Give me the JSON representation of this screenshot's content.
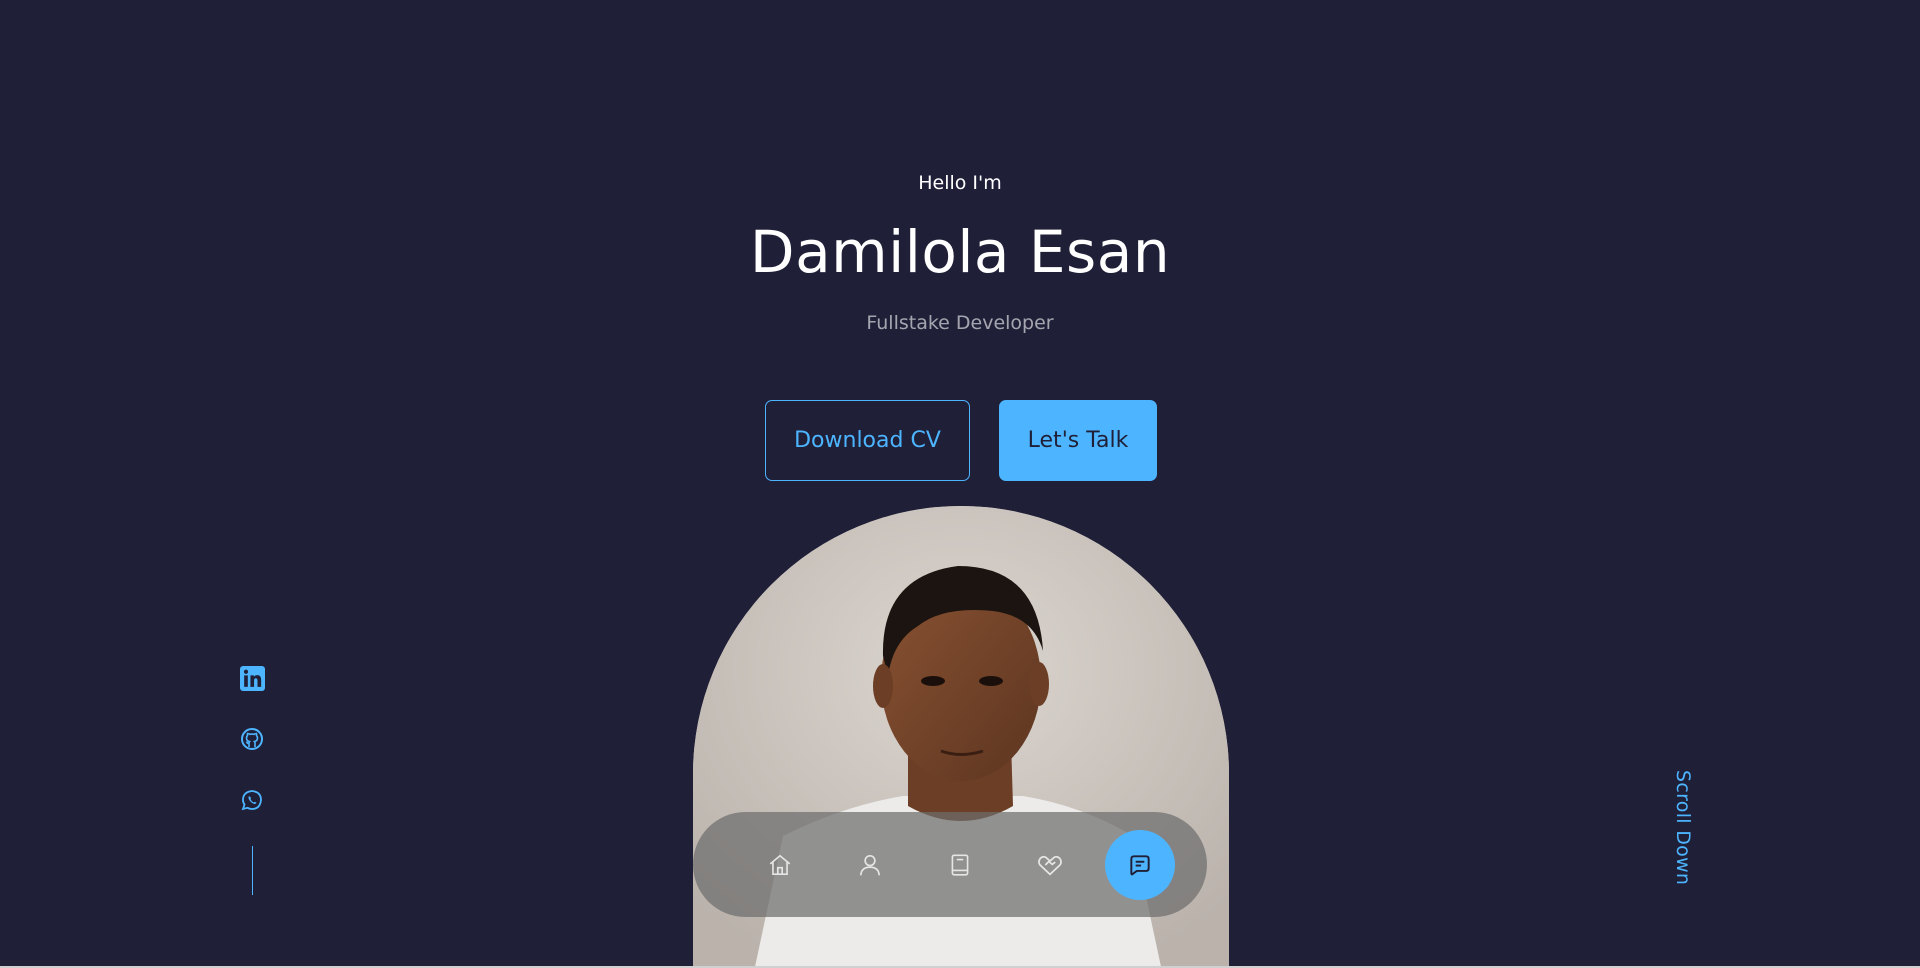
{
  "hero": {
    "greeting": "Hello I'm",
    "name": "Damilola Esan",
    "role": "Fullstake Developer",
    "download_cv_label": "Download CV",
    "lets_talk_label": "Let's Talk"
  },
  "socials": [
    {
      "name": "linkedin-icon"
    },
    {
      "name": "github-icon"
    },
    {
      "name": "whatsapp-icon"
    }
  ],
  "scroll_down_label": "Scroll Down",
  "nav": {
    "items": [
      {
        "icon": "home-icon",
        "active": false
      },
      {
        "icon": "user-icon",
        "active": false
      },
      {
        "icon": "book-icon",
        "active": false
      },
      {
        "icon": "handshake-icon",
        "active": false
      },
      {
        "icon": "message-icon",
        "active": true
      }
    ]
  },
  "colors": {
    "background": "#1f1f38",
    "accent": "#4db5ff",
    "text": "#ffffff"
  }
}
